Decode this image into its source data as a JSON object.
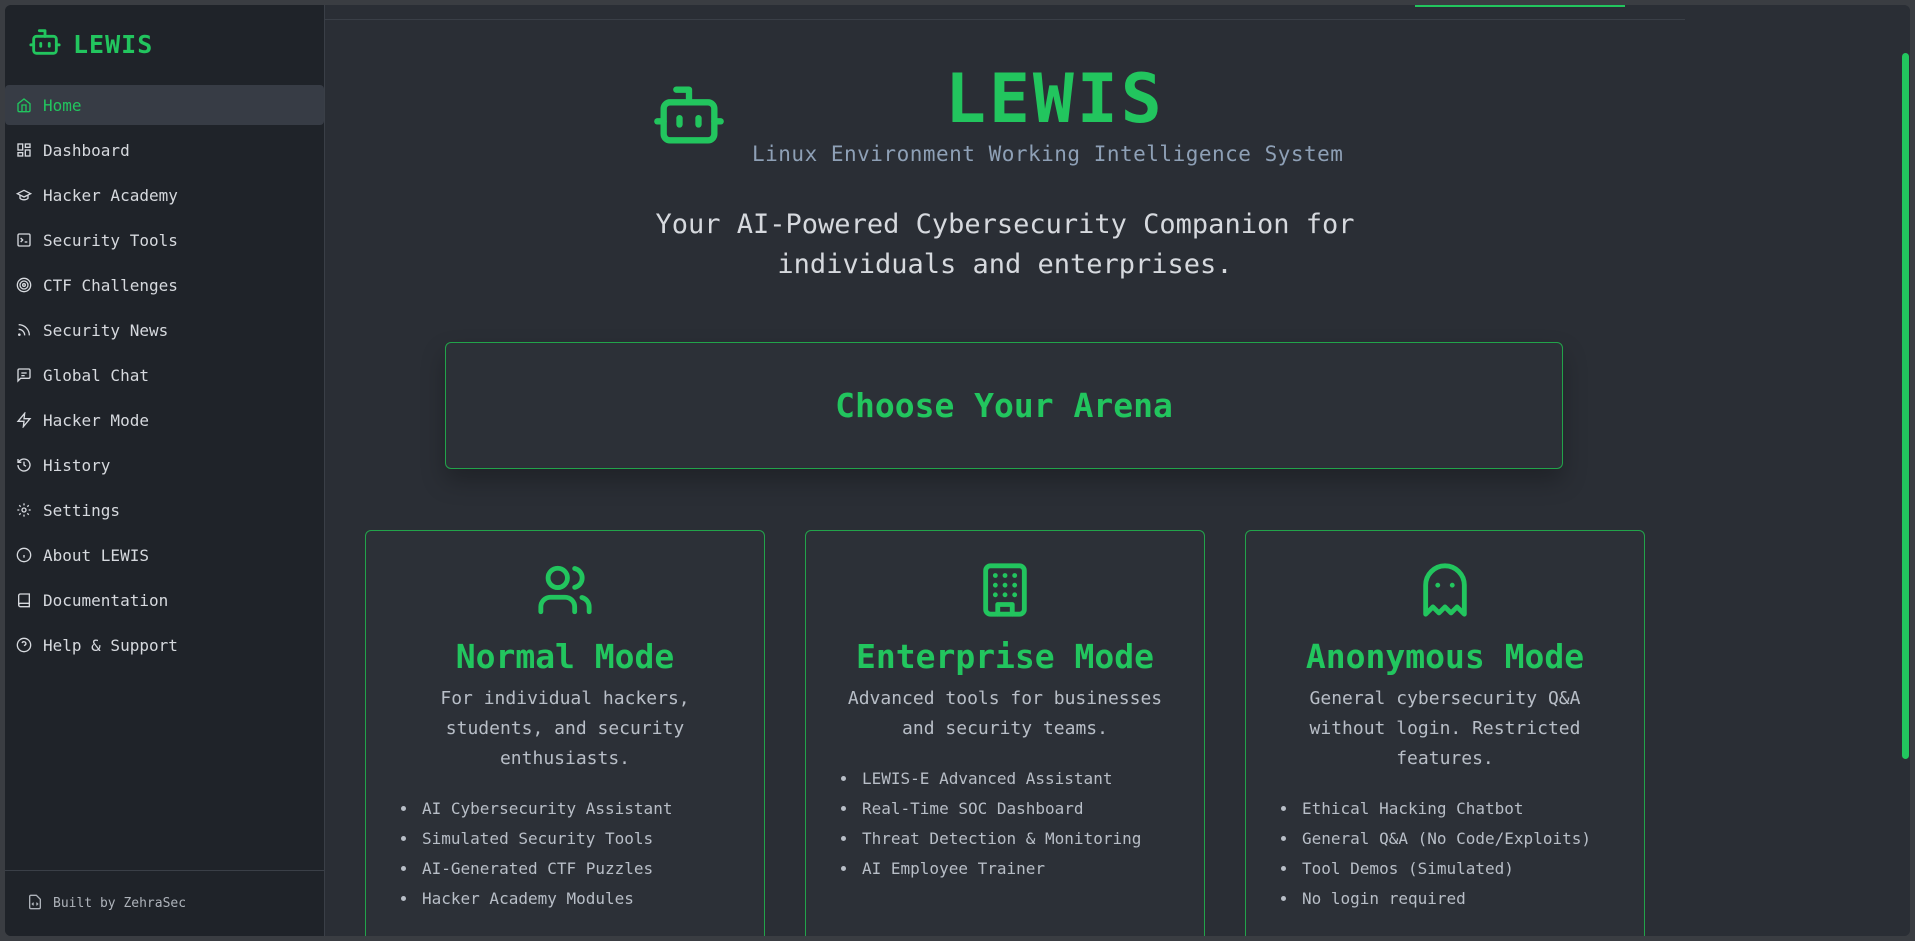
{
  "brand": {
    "name": "LEWIS",
    "icon": "bot-icon"
  },
  "sidebar": {
    "items": [
      {
        "label": "Home",
        "icon": "home-icon",
        "active": true
      },
      {
        "label": "Dashboard",
        "icon": "dashboard-icon"
      },
      {
        "label": "Hacker Academy",
        "icon": "graduation-cap-icon"
      },
      {
        "label": "Security Tools",
        "icon": "terminal-icon"
      },
      {
        "label": "CTF Challenges",
        "icon": "target-icon"
      },
      {
        "label": "Security News",
        "icon": "rss-icon"
      },
      {
        "label": "Global Chat",
        "icon": "chat-icon"
      },
      {
        "label": "Hacker Mode",
        "icon": "zap-icon"
      },
      {
        "label": "History",
        "icon": "history-icon"
      },
      {
        "label": "Settings",
        "icon": "gear-icon"
      },
      {
        "label": "About LEWIS",
        "icon": "info-icon"
      },
      {
        "label": "Documentation",
        "icon": "book-icon"
      },
      {
        "label": "Help & Support",
        "icon": "help-icon"
      }
    ],
    "footer": "Built by ZehraSec"
  },
  "hero": {
    "title": "LEWIS",
    "subtitle": "Linux Environment Working Intelligence System",
    "tagline": "Your AI-Powered Cybersecurity Companion for individuals and enterprises."
  },
  "arena": {
    "label": "Choose Your Arena"
  },
  "cards": [
    {
      "title": "Normal Mode",
      "icon": "users-icon",
      "desc": "For individual hackers, students, and security enthusiasts.",
      "features": [
        "AI Cybersecurity Assistant",
        "Simulated Security Tools",
        "AI-Generated CTF Puzzles",
        "Hacker Academy Modules"
      ]
    },
    {
      "title": "Enterprise Mode",
      "icon": "building-icon",
      "desc": "Advanced tools for businesses and security teams.",
      "features": [
        "LEWIS-E Advanced Assistant",
        "Real-Time SOC Dashboard",
        "Threat Detection & Monitoring",
        "AI Employee Trainer"
      ]
    },
    {
      "title": "Anonymous Mode",
      "icon": "ghost-icon",
      "desc": "General cybersecurity Q&A without login. Restricted features.",
      "features": [
        "Ethical Hacking Chatbot",
        "General Q&A (No Code/Exploits)",
        "Tool Demos (Simulated)",
        "No login required"
      ]
    }
  ],
  "colors": {
    "accent": "#22c55e",
    "sidebar_bg": "#1f2329",
    "main_bg": "#2a2e35"
  }
}
